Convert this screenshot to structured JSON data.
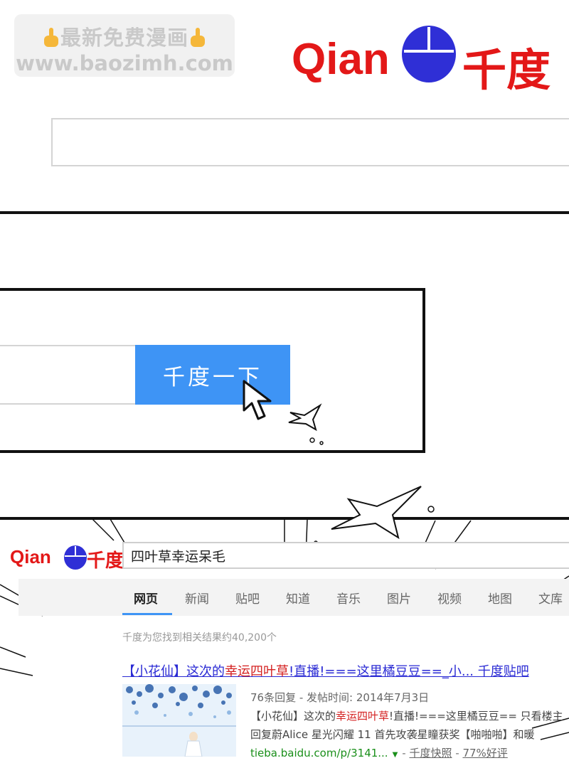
{
  "watermark": {
    "line1": "最新免费漫画",
    "line2": "www.baozimh.com"
  },
  "logo": {
    "latin": "Qian",
    "chinese": "千度",
    "brand_red": "#e31818",
    "paw_blue": "#2f2fd6"
  },
  "panel2": {
    "search_button_label": "千度一下",
    "button_color": "#3e94f5"
  },
  "results_page": {
    "query": "四叶草幸运呆毛",
    "tabs": [
      "网页",
      "新闻",
      "贴吧",
      "知道",
      "音乐",
      "图片",
      "视频",
      "地图",
      "文库"
    ],
    "active_tab": "网页",
    "result_count": "千度为您找到相关结果约40,200个",
    "result": {
      "title_a": "【小花仙】这次的",
      "title_hl": "幸运四叶草",
      "title_b": "!直播!===这里橘豆豆==_小... 千度贴吧",
      "meta": "76条回复 - 发帖时间: 2014年7月3日",
      "snippet1_a": "【小花仙】这次的",
      "snippet1_hl": "幸运四叶草",
      "snippet1_b": "!直播!===这里橘豆豆== 只看楼主",
      "snippet2": "回复蔚Alice 星光闪耀 11 首先攻袭星瞳获奖【啪啪啪】和暖",
      "url": "tieba.baidu.com/p/3141...",
      "cache": "千度快照",
      "rating": "77%好评"
    }
  }
}
